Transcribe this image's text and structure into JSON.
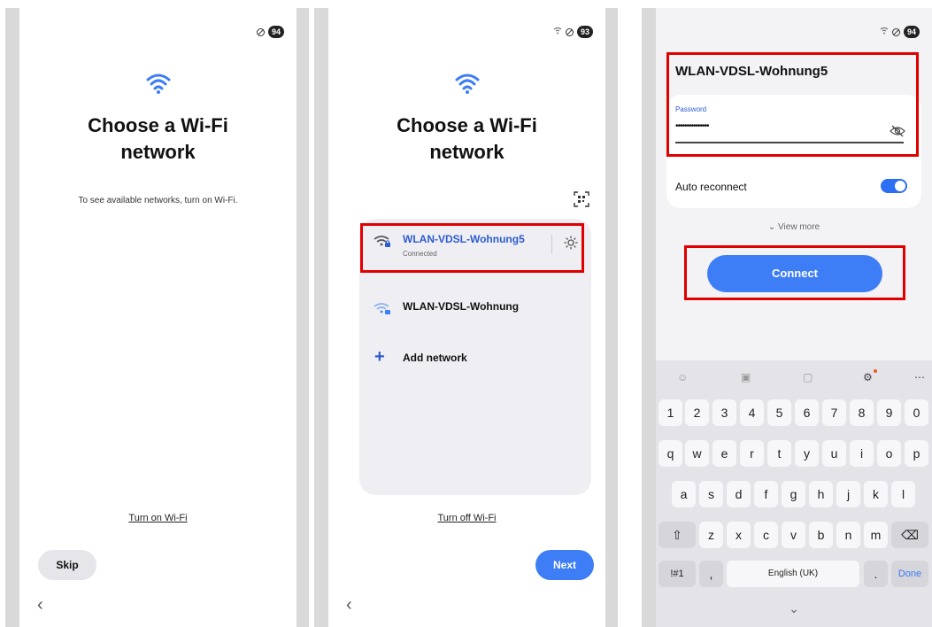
{
  "panel1": {
    "status_badge": "94",
    "title_line1": "Choose a Wi-Fi",
    "title_line2": "network",
    "hint": "To see available networks, turn on Wi-Fi.",
    "wifi_toggle_link": "Turn on Wi-Fi",
    "skip_label": "Skip",
    "back_glyph": "‹"
  },
  "panel2": {
    "status_badge": "93",
    "title_line1": "Choose a Wi-Fi",
    "title_line2": "network",
    "networks": [
      {
        "name": "WLAN-VDSL-Wohnung5",
        "status": "Connected",
        "icon": "wifi-lock-icon"
      },
      {
        "name": "WLAN-VDSL-Wohnung",
        "status": "",
        "icon": "wifi-lock-icon"
      }
    ],
    "add_network_label": "Add network",
    "plus_glyph": "+",
    "wifi_toggle_link": "Turn off Wi-Fi",
    "next_label": "Next",
    "back_glyph": "‹"
  },
  "panel3": {
    "status_badge": "94",
    "ssid": "WLAN-VDSL-Wohnung5",
    "password_label": "Password",
    "password_value": "•••••••••••••••",
    "auto_reconnect_label": "Auto reconnect",
    "auto_reconnect_on": true,
    "view_more_label": "⌄  View more",
    "connect_label": "Connect",
    "keyboard": {
      "number_row": [
        "1",
        "2",
        "3",
        "4",
        "5",
        "6",
        "7",
        "8",
        "9",
        "0"
      ],
      "row1": [
        "q",
        "w",
        "e",
        "r",
        "t",
        "y",
        "u",
        "i",
        "o",
        "p"
      ],
      "row2": [
        "a",
        "s",
        "d",
        "f",
        "g",
        "h",
        "j",
        "k",
        "l"
      ],
      "row3": [
        "z",
        "x",
        "c",
        "v",
        "b",
        "n",
        "m"
      ],
      "symbols_key": "!#1",
      "comma_key": ",",
      "space_label": "English (UK)",
      "period_key": ".",
      "done_label": "Done",
      "shift_glyph": "⇧",
      "backspace_glyph": "⌫",
      "hide_glyph": "⌄"
    }
  },
  "colors": {
    "accent": "#3d7df5",
    "highlight_box": "#e00000",
    "link_blue": "#2d5bcf"
  }
}
